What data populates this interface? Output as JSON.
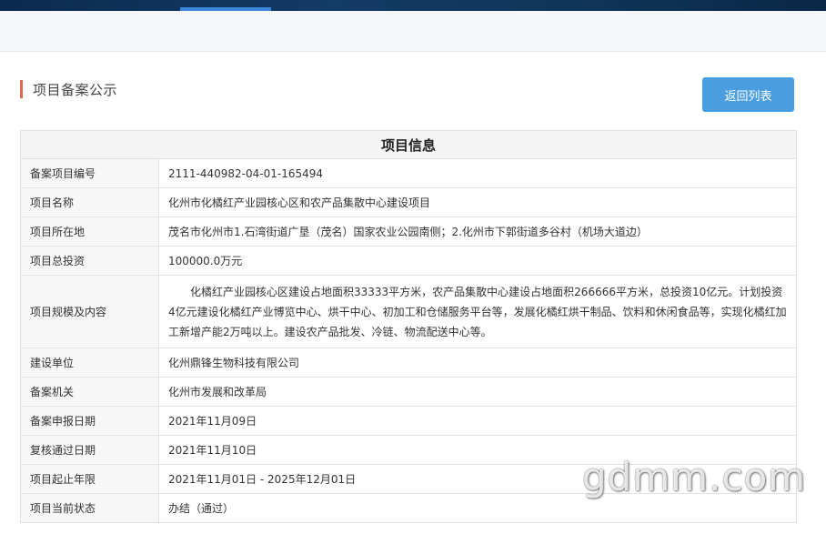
{
  "section": {
    "title": "项目备案公示"
  },
  "actions": {
    "back_label": "返回列表"
  },
  "table": {
    "caption": "项目信息",
    "rows": [
      {
        "label": "备案项目编号",
        "value": "2111-440982-04-01-165494"
      },
      {
        "label": "项目名称",
        "value": "化州市化橘红产业园核心区和农产品集散中心建设项目"
      },
      {
        "label": "项目所在地",
        "value": "茂名市化州市1.石湾街道广垦（茂名）国家农业公园南侧；2.化州市下郭街道多谷村（机场大道边）"
      },
      {
        "label": "项目总投资",
        "value": "100000.0万元"
      },
      {
        "label": "项目规模及内容",
        "value": "化橘红产业园核心区建设占地面积33333平方米，农产品集散中心建设占地面积266666平方米，总投资10亿元。计划投资4亿元建设化橘红产业博览中心、烘干中心、初加工和仓储服务平台等，发展化橘红烘干制品、饮料和休闲食品等，实现化橘红加工新增产能2万吨以上。建设农产品批发、冷链、物流配送中心等。"
      },
      {
        "label": "建设单位",
        "value": "化州鼎锋生物科技有限公司"
      },
      {
        "label": "备案机关",
        "value": "化州市发展和改革局"
      },
      {
        "label": "备案申报日期",
        "value": "2021年11月09日"
      },
      {
        "label": "复核通过日期",
        "value": "2021年11月10日"
      },
      {
        "label": "项目起止年限",
        "value": "2021年11月01日 - 2025年12月01日"
      },
      {
        "label": "项目当前状态",
        "value": "办结（通过）"
      }
    ]
  },
  "watermark": {
    "text": "gdmm.com"
  }
}
